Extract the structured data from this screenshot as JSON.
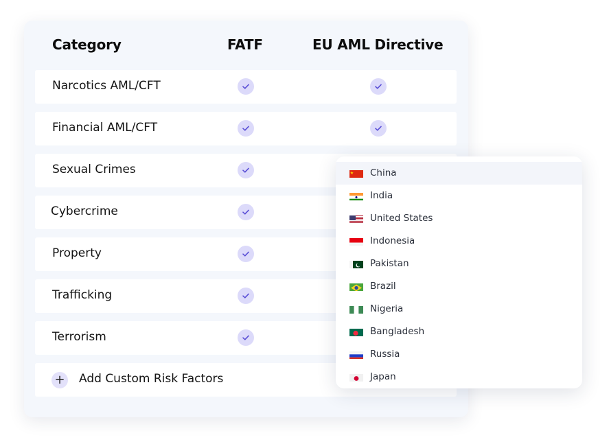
{
  "table": {
    "headers": {
      "category": "Category",
      "fatf": "FATF",
      "eu": "EU AML Directive"
    },
    "rows": [
      {
        "label": "Narcotics AML/CFT",
        "fatf": true,
        "eu": true
      },
      {
        "label": "Financial AML/CFT",
        "fatf": true,
        "eu": true
      },
      {
        "label": "Sexual Crimes",
        "fatf": true,
        "eu": true
      },
      {
        "label": "Cybercrime",
        "fatf": true,
        "eu": true
      },
      {
        "label": "Property",
        "fatf": true,
        "eu": true
      },
      {
        "label": "Trafficking",
        "fatf": true,
        "eu": true
      },
      {
        "label": "Terrorism",
        "fatf": true,
        "eu": true
      }
    ],
    "add_label": "Add Custom Risk Factors",
    "check_icon": "check-icon",
    "plus_icon": "plus-icon"
  },
  "dropdown": {
    "selected_index": 0,
    "options": [
      {
        "name": "China",
        "flag": "flag-china"
      },
      {
        "name": "India",
        "flag": "flag-india"
      },
      {
        "name": "United States",
        "flag": "flag-united-states"
      },
      {
        "name": "Indonesia",
        "flag": "flag-indonesia"
      },
      {
        "name": "Pakistan",
        "flag": "flag-pakistan"
      },
      {
        "name": "Brazil",
        "flag": "flag-brazil"
      },
      {
        "name": "Nigeria",
        "flag": "flag-nigeria"
      },
      {
        "name": "Bangladesh",
        "flag": "flag-bangladesh"
      },
      {
        "name": "Russia",
        "flag": "flag-russia"
      },
      {
        "name": "Japan",
        "flag": "flag-japan"
      }
    ]
  },
  "colors": {
    "accent_check_bg": "#dcdafa",
    "accent_check_stroke": "#5a4fd6",
    "panel_bg": "#f4f7fc",
    "selected_option_bg": "#f3f5fa"
  }
}
